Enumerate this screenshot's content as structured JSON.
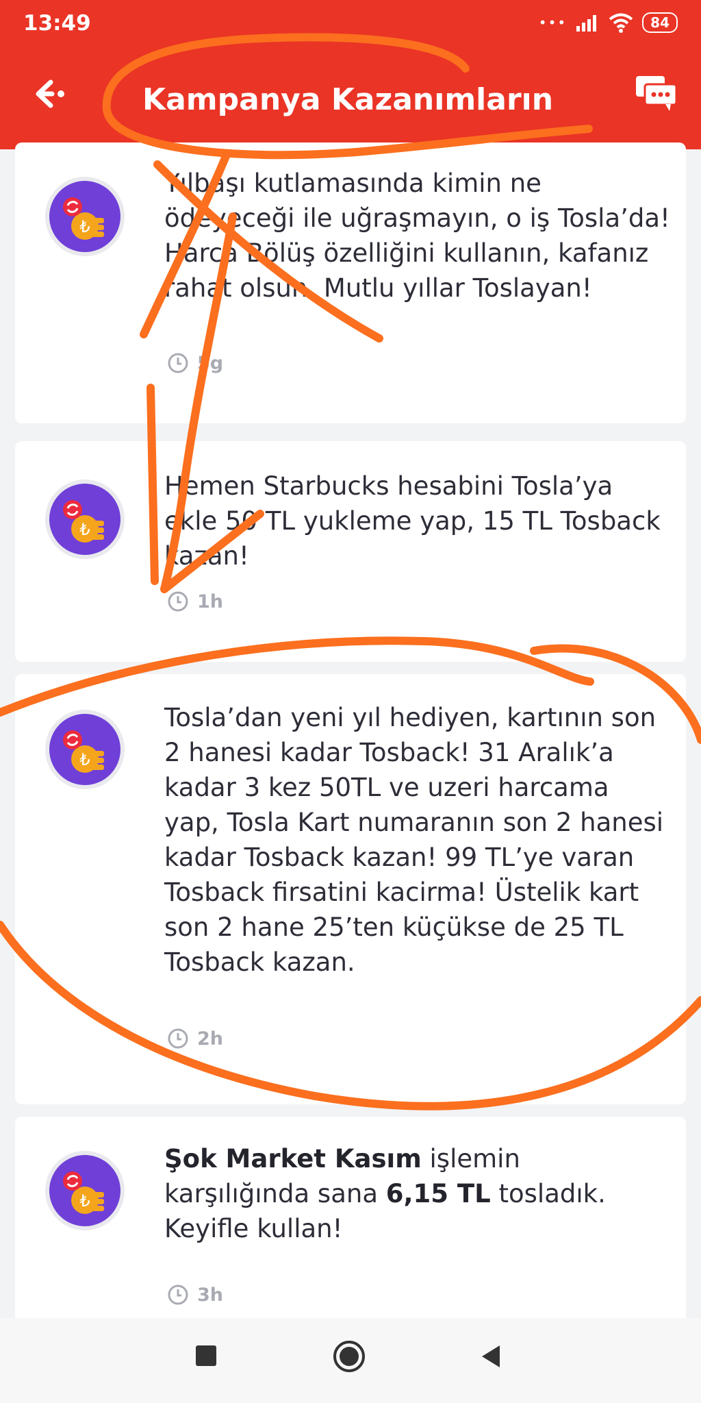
{
  "status_bar": {
    "time": "13:49",
    "battery": "84",
    "icons": [
      "signal-dots-icon",
      "signal-icon",
      "wifi-icon",
      "battery-icon"
    ]
  },
  "header": {
    "title": "Kampanya Kazanımların",
    "back_icon": "back-arrow-icon",
    "chat_icon": "chat-icon",
    "background": "#ea3426"
  },
  "notifications": [
    {
      "text": "Yılbaşı kutlamasında kimin ne ödeyeceği ile uğraşmayın, o iş Tosla’da! Harca Bölüş özelliğini kullanın, kafanız rahat olsun. Mutlu yıllar Toslayan!",
      "time": "5g"
    },
    {
      "text": "Hemen Starbucks hesabini Tosla’ya ekle 50 TL yukleme yap, 15 TL Tosback kazan!",
      "time": "1h"
    },
    {
      "text": "Tosla’dan yeni yıl hediyen, kartının son 2 hanesi kadar Tosback! 31 Aralık’a kadar 3 kez 50TL ve uzeri harcama yap, Tosla Kart numaranın son 2 hanesi kadar Tosback kazan! 99 TL’ye varan Tosback firsatini kacirma! Üstelik kart son 2 hane 25’ten küçükse de 25 TL Tosback kazan.",
      "time": "2h"
    },
    {
      "parts": {
        "bold1": "Şok Market Kasım",
        "text1": " işlemin karşılığında sana ",
        "bold2": "6,15 TL",
        "text2": " tosladık. Keyifle kullan!"
      },
      "time": "3h"
    }
  ],
  "nav_bar": {
    "icons": [
      "recents-square-icon",
      "home-circle-icon",
      "back-triangle-icon"
    ]
  },
  "colors": {
    "brand_red": "#ea3426",
    "annotation_orange": "#fb6f1e",
    "avatar_purple": "#6f3fd8",
    "coin_gold": "#f4a51c"
  }
}
